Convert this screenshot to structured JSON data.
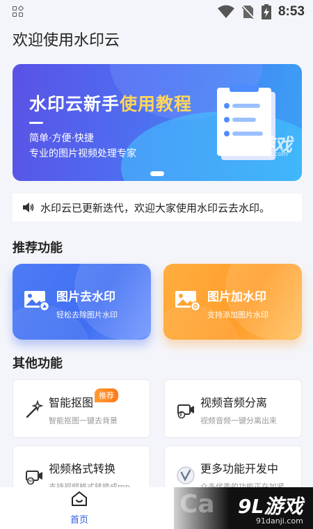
{
  "status_bar": {
    "time": "8:53",
    "icons": [
      "app-grid-icon",
      "wifi-icon",
      "no-sim-icon",
      "battery-charging-icon"
    ]
  },
  "page_title": "欢迎使用水印云",
  "banner": {
    "title_plain": "水印云新手",
    "title_highlight": "使用教程",
    "subtitle1": "简单·方便·快捷",
    "subtitle2": "专业的图片视频处理专家",
    "watermark": "91游戏",
    "watermark_url": "91danji.com"
  },
  "notice": {
    "icon": "speaker-icon",
    "text": "水印云已更新迭代，欢迎大家使用水印云去水印。"
  },
  "recommended": {
    "title": "推荐功能",
    "items": [
      {
        "name": "图片去水印",
        "desc": "轻松去除图片水印",
        "icon": "image-remove-watermark-icon",
        "color": "#4675f3"
      },
      {
        "name": "图片加水印",
        "desc": "支持添加图片水印",
        "icon": "image-add-watermark-icon",
        "color": "#ffa433"
      }
    ]
  },
  "other": {
    "title": "其他功能",
    "items": [
      {
        "name": "智能抠图",
        "desc": "智能抠图一键去背景",
        "icon": "magic-wand-icon",
        "badge": "推荐"
      },
      {
        "name": "视频音频分离",
        "desc": "视频音频一键分离出来",
        "icon": "video-audio-icon"
      },
      {
        "name": "视频格式转换",
        "desc": "支持视频格式转换成mp",
        "icon": "video-convert-icon"
      },
      {
        "name": "更多功能开发中",
        "desc": "众多优秀的功能正在加紧",
        "icon": "more-check-icon"
      }
    ]
  },
  "bottom_nav": {
    "home_label": "首页"
  },
  "footer_watermark": {
    "brand": "9L游戏",
    "url": "91danji.com"
  },
  "colors": {
    "accent": "#2c5be8",
    "blue_card": "#4675f3",
    "orange_card": "#ffa433",
    "badge": "#ff8a25"
  }
}
